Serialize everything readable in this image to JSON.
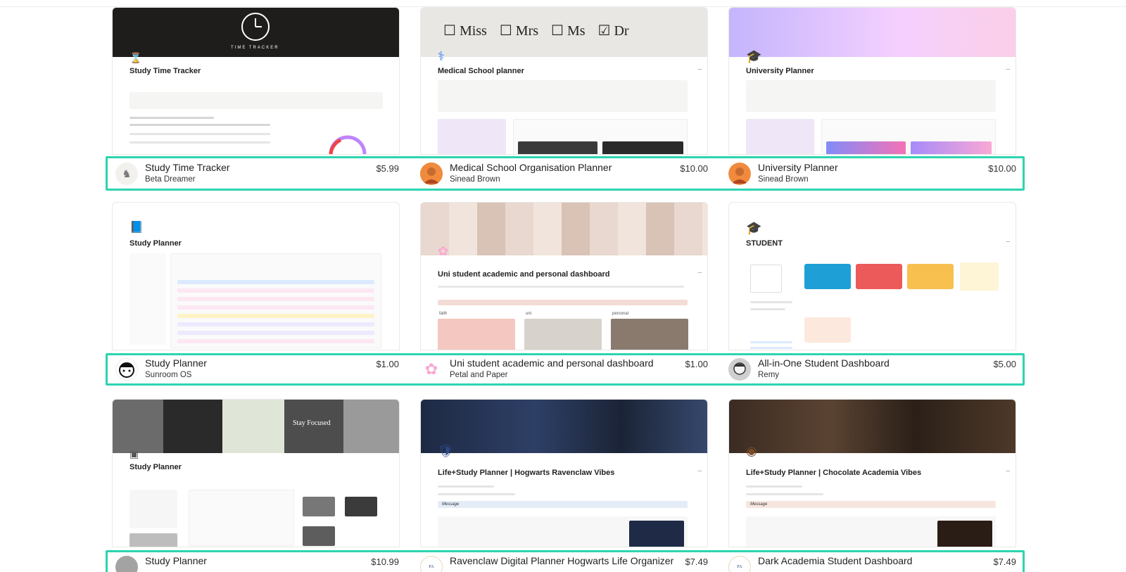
{
  "rows": [
    {
      "listings": [
        {
          "title": "Study Time Tracker",
          "author": "Beta Dreamer",
          "price": "$5.99",
          "avatar_icon": "deer-icon",
          "preview_title": "Study Time Tracker",
          "preview_icon": "hourglass-icon",
          "cover_text": "TIME TRACKER"
        },
        {
          "title": "Medical School Organisation Planner",
          "author": "Sinead Brown",
          "price": "$10.00",
          "avatar_icon": "portrait-icon",
          "preview_title": "Medical School planner",
          "preview_icon": "stethoscope-icon",
          "cover_options": [
            "Miss",
            "Mrs",
            "Ms",
            "Dr"
          ]
        },
        {
          "title": "University Planner",
          "author": "Sinead Brown",
          "price": "$10.00",
          "avatar_icon": "portrait-icon",
          "preview_title": "University Planner",
          "preview_icon": "graduation-cap-icon"
        }
      ]
    },
    {
      "listings": [
        {
          "title": "Study Planner",
          "author": "Sunroom OS",
          "price": "$1.00",
          "avatar_icon": "face-icon",
          "preview_title": "Study Planner",
          "preview_icon": "book-icon"
        },
        {
          "title": "Uni student academic and personal dashboard",
          "author": "Petal and Paper",
          "price": "$1.00",
          "avatar_icon": "flower-icon",
          "preview_title": "Uni student academic and personal dashboard",
          "preview_icon": "blossom-icon",
          "preview_sections": [
            "faith",
            "uni",
            "personal"
          ]
        },
        {
          "title": "All-in-One Student Dashboard",
          "author": "Remy",
          "price": "$5.00",
          "avatar_icon": "face-icon",
          "preview_title": "STUDENT",
          "preview_icon": "graduation-cap-icon"
        }
      ]
    },
    {
      "listings": [
        {
          "title": "Study Planner",
          "author": "",
          "price": "$10.99",
          "avatar_icon": "gray-avatar-icon",
          "preview_title": "Study Planner",
          "preview_icon": "notebook-icon",
          "cover_text": "Stay Focused"
        },
        {
          "title": "Ravenclaw Digital Planner Hogwarts Life Organizer",
          "author": "",
          "price": "$7.49",
          "avatar_icon": "final-avenue-logo-icon",
          "preview_title": "Life+Study Planner | Hogwarts Ravenclaw Vibes",
          "preview_icon": "crest-icon",
          "preview_message": "Message"
        },
        {
          "title": "Dark Academia Student Dashboard",
          "author": "",
          "price": "$7.49",
          "avatar_icon": "final-avenue-logo-icon",
          "preview_title": "Life+Study Planner | Chocolate Academia Vibes",
          "preview_icon": "donut-icon",
          "preview_message": "Message"
        }
      ]
    }
  ],
  "colors": {
    "highlight": "#2dd4b0"
  }
}
